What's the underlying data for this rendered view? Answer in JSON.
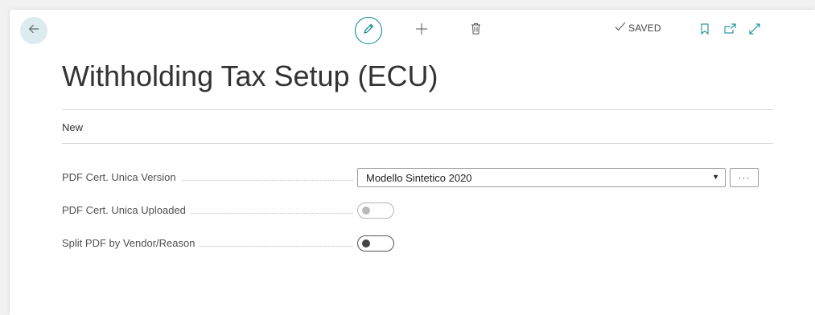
{
  "header": {
    "saved_label": "SAVED",
    "title": "Withholding Tax Setup (ECU)"
  },
  "actions": {
    "new_label": "New"
  },
  "fields": [
    {
      "label": "PDF Cert. Unica Version",
      "value": "Modello Sintetico 2020",
      "more_label": "···"
    },
    {
      "label": "PDF Cert. Unica Uploaded",
      "checked": false,
      "enabled": false
    },
    {
      "label": "Split PDF by Vendor/Reason",
      "checked": false,
      "enabled": true
    }
  ],
  "icons": {
    "back": "back-arrow-icon",
    "edit": "pencil-icon",
    "new": "plus-icon",
    "delete": "trash-icon",
    "saved": "checkmark-icon",
    "bookmark": "bookmark-icon",
    "open_new_window": "open-new-window-icon",
    "expand": "expand-icon",
    "dropdown": "dropdown-arrow-icon"
  },
  "colors": {
    "accent": "#00848f",
    "back_button_bg": "#dcebee"
  }
}
